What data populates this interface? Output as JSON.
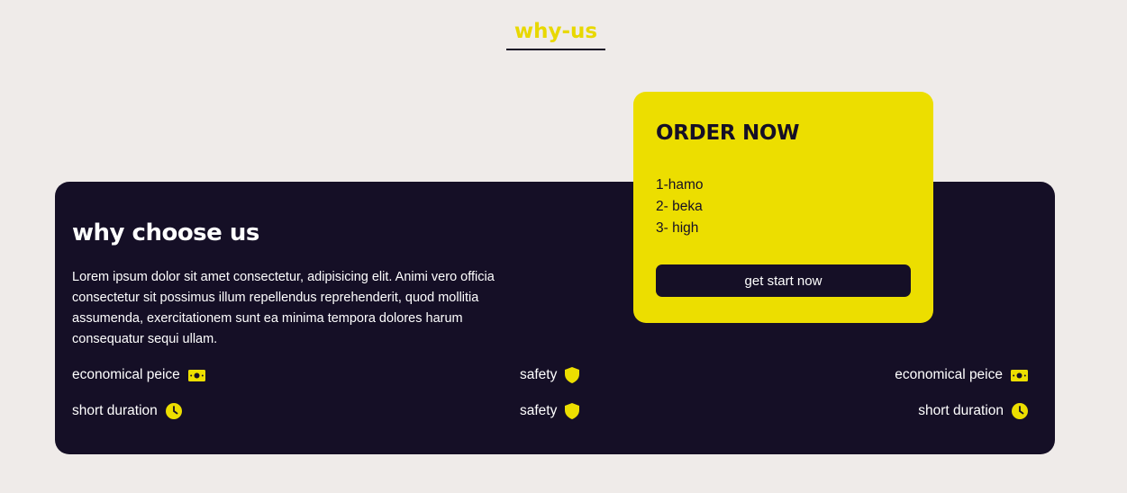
{
  "header": {
    "title": "why-us"
  },
  "panel": {
    "heading": "why choose us",
    "text": "Lorem ipsum dolor sit amet consectetur, adipisicing elit. Animi vero officia consectetur sit possimus illum repellendus reprehenderit, quod mollitia assumenda, exercitationem sunt ea minima tempora dolores harum consequatur sequi ullam.",
    "features": [
      {
        "label": "economical peice",
        "icon": "money-icon"
      },
      {
        "label": "safety",
        "icon": "shield-icon"
      },
      {
        "label": "economical peice",
        "icon": "money-icon"
      },
      {
        "label": "short duration",
        "icon": "clock-icon"
      },
      {
        "label": "safety",
        "icon": "shield-icon"
      },
      {
        "label": "short duration",
        "icon": "clock-icon"
      }
    ]
  },
  "order": {
    "title": "ORDER NOW",
    "items": [
      "1-hamo",
      "2- beka",
      "3- high"
    ],
    "button_label": "get start now"
  },
  "colors": {
    "background": "#efebe9",
    "dark": "#150f26",
    "accent": "#ecde00"
  }
}
